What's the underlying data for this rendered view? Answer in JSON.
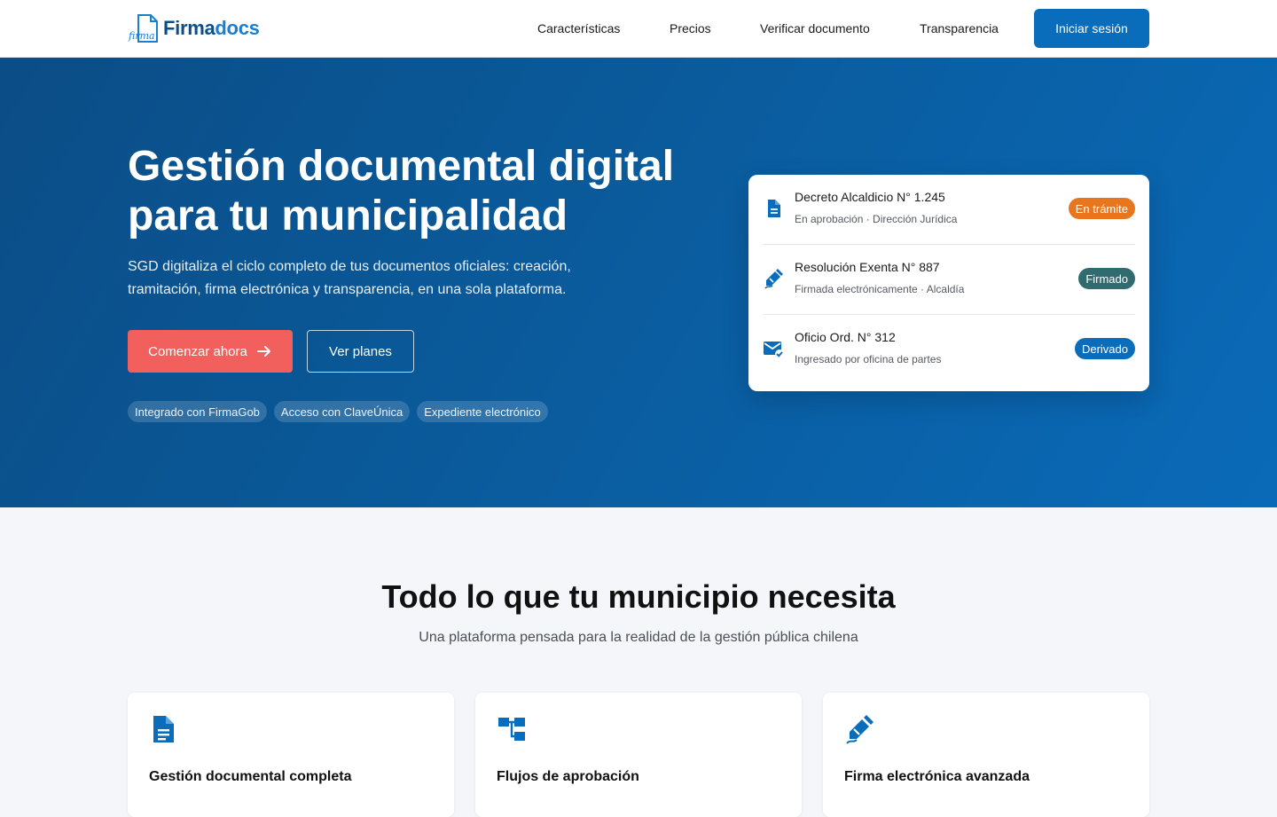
{
  "header": {
    "logo_script": "firma",
    "logo_part1": "Firma",
    "logo_part2": "docs",
    "nav": [
      "Características",
      "Precios",
      "Verificar documento",
      "Transparencia"
    ],
    "login_label": "Iniciar sesión"
  },
  "hero": {
    "title_line1": "Gestión documental digital",
    "title_line2": "para tu municipalidad",
    "subtitle": "SGD digitaliza el ciclo completo de tus documentos oficiales: creación, tramitación, firma electrónica y transparencia, en una sola plataforma.",
    "primary_cta": "Comenzar ahora",
    "secondary_cta": "Ver planes",
    "chips": [
      "Integrado con FirmaGob",
      "Acceso con ClaveÚnica",
      "Expediente electrónico"
    ]
  },
  "documents": [
    {
      "title": "Decreto Alcaldicio N° 1.245",
      "meta": "En aprobación · Dirección Jurídica",
      "status": "En trámite",
      "status_color": "#e8761f",
      "icon": "document-icon"
    },
    {
      "title": "Resolución Exenta N° 887",
      "meta": "Firmada electrónicamente · Alcaldía",
      "status": "Firmado",
      "status_color": "#2f6b6f",
      "icon": "signature-icon"
    },
    {
      "title": "Oficio Ord. N° 312",
      "meta": "Ingresado por oficina de partes",
      "status": "Derivado",
      "status_color": "#0a6dbb",
      "icon": "mail-check-icon"
    }
  ],
  "features_section": {
    "title": "Todo lo que tu municipio necesita",
    "subtitle": "Una plataforma pensada para la realidad de la gestión pública chilena",
    "items": [
      {
        "title": "Gestión documental completa",
        "icon": "document-icon"
      },
      {
        "title": "Flujos de aprobación",
        "icon": "workflow-icon"
      },
      {
        "title": "Firma electrónica avanzada",
        "icon": "signature-icon"
      }
    ]
  },
  "colors": {
    "brand_blue": "#0a6dbb",
    "cta_coral": "#f2605d",
    "hero_dark": "#0b4d86"
  }
}
